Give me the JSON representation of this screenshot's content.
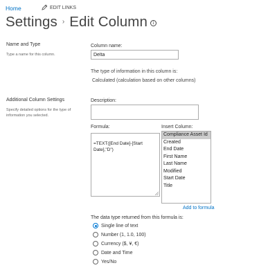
{
  "nav": {
    "home": "Home",
    "edit_links": "EDIT LINKS"
  },
  "breadcrumb": {
    "parent": "Settings",
    "current": "Edit Column",
    "separator": "›"
  },
  "name_type": {
    "section_title": "Name and Type",
    "section_desc": "Type a name for this column.",
    "column_name_label": "Column name:",
    "column_name_value": "Delta",
    "type_label": "The type of information in this column is:",
    "type_value": "Calculated (calculation based on other columns)"
  },
  "additional": {
    "section_title": "Additional Column Settings",
    "section_desc": "Specify detailed options for the type of information you selected.",
    "description_label": "Description:",
    "description_value": "",
    "formula_label": "Formula:",
    "formula_value": "=TEXT([End Date]-[Start Date],\"D\")",
    "insert_column_label": "Insert Column:",
    "insert_columns": [
      "Compliance Asset Id",
      "Created",
      "End Date",
      "First Name",
      "Last Name",
      "Modified",
      "Start Date",
      "Title"
    ],
    "insert_selected_index": 0,
    "add_to_formula": "Add to formula",
    "return_type_label": "The data type returned from this formula is:",
    "return_types": [
      "Single line of text",
      "Number (1, 1.0, 100)",
      "Currency ($, ¥, €)",
      "Date and Time",
      "Yes/No"
    ],
    "return_type_selected_index": 0
  },
  "colors": {
    "link": "#0072c6",
    "radio_accent": "#0078d4",
    "selected_option_bg": "#cdcdcd"
  },
  "icons": {
    "edit": "pencil-icon",
    "info": "info-icon",
    "breadcrumb_separator": "chevron-right-icon"
  }
}
